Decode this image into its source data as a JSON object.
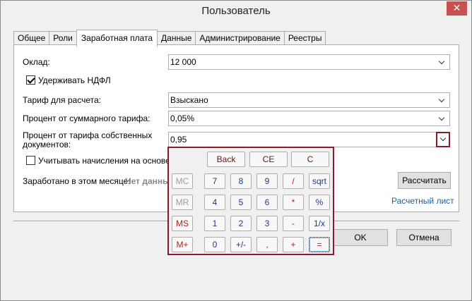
{
  "window": {
    "title": "Пользователь",
    "close_glyph": "✕"
  },
  "tabs": [
    {
      "label": "Общее"
    },
    {
      "label": "Роли"
    },
    {
      "label": "Заработная плата"
    },
    {
      "label": "Данные"
    },
    {
      "label": "Администрирование"
    },
    {
      "label": "Реестры"
    }
  ],
  "form": {
    "salary_label": "Оклад:",
    "salary_value": "12 000",
    "withhold_ndfl_label": "Удерживать НДФЛ",
    "withhold_ndfl_checked": true,
    "tariff_label": "Тариф для расчета:",
    "tariff_value": "Взыскано",
    "percent_total_label": "Процент от суммарного тарифа:",
    "percent_total_value": "0,05%",
    "percent_own_label_line1": "Процент от тарифа собственных",
    "percent_own_label_line2": "документов:",
    "percent_own_value": "0,95",
    "consider_label": "Учитывать начисления на основе ат",
    "consider_checked": false,
    "earned_label": "Заработано в этом месяце:",
    "earned_value": "Нет данны",
    "calculate_button": "Рассчитать",
    "payslip_link": "Расчетный лист"
  },
  "footer": {
    "ok_button": "OK",
    "cancel_button": "Отмена"
  },
  "calculator": {
    "back": "Back",
    "ce": "CE",
    "c": "C",
    "mc": "MC",
    "mr": "MR",
    "ms": "MS",
    "mplus": "M+",
    "k7": "7",
    "k8": "8",
    "k9": "9",
    "div": "/",
    "sqrt": "sqrt",
    "k4": "4",
    "k5": "5",
    "k6": "6",
    "mul": "*",
    "pct": "%",
    "k1": "1",
    "k2": "2",
    "k3": "3",
    "minus": "-",
    "inv": "1/x",
    "k0": "0",
    "sign": "+/-",
    "dot": ",",
    "plus": "+",
    "eq": "="
  },
  "colors": {
    "accent_border": "#8b1a2b",
    "link": "#1a5dad",
    "close": "#c75050"
  }
}
